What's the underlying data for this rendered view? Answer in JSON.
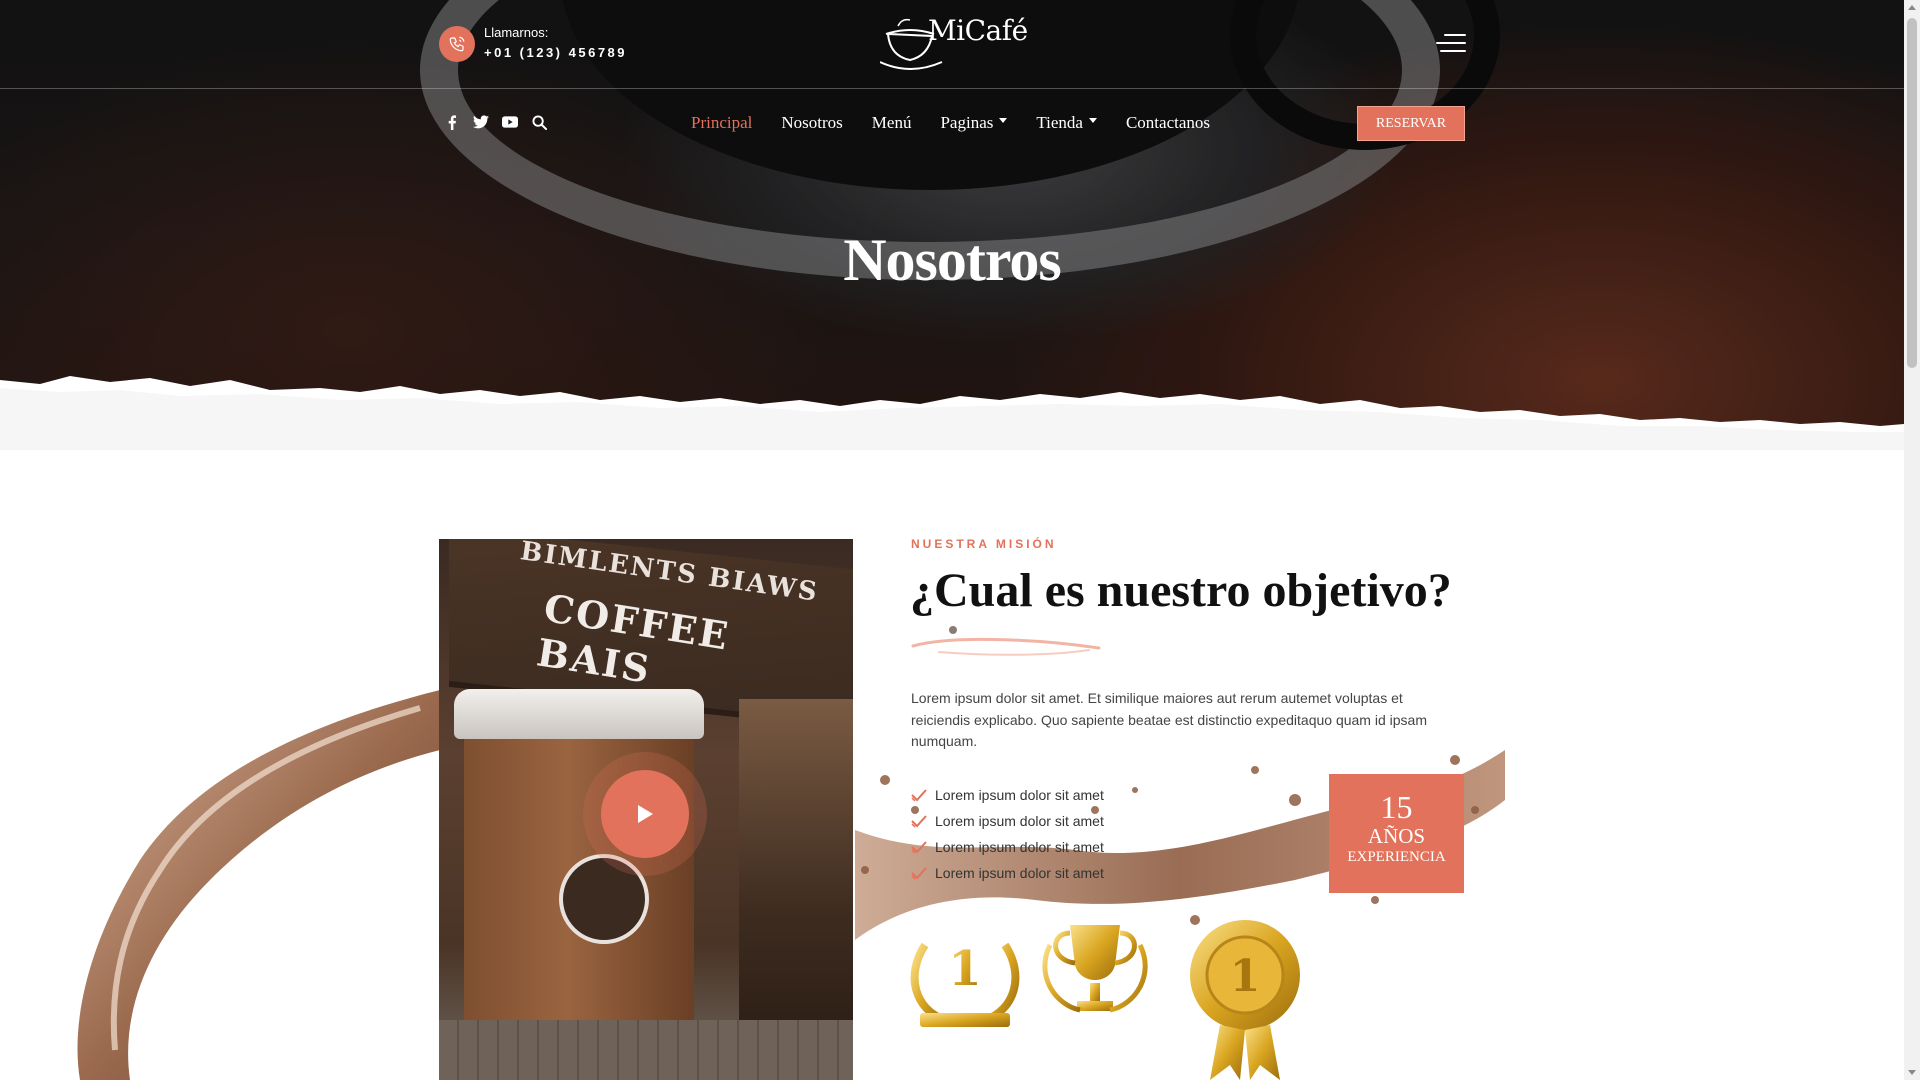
{
  "header": {
    "call_label": "Llamarnos:",
    "call_number": "+01 (123) 456789",
    "logo_text": "MiCafé"
  },
  "nav": {
    "items": [
      {
        "label": "Principal",
        "active": true,
        "dropdown": false
      },
      {
        "label": "Nosotros",
        "active": false,
        "dropdown": false
      },
      {
        "label": "Menú",
        "active": false,
        "dropdown": false
      },
      {
        "label": "Paginas",
        "active": false,
        "dropdown": true
      },
      {
        "label": "Tienda",
        "active": false,
        "dropdown": true
      },
      {
        "label": "Contactanos",
        "active": false,
        "dropdown": false
      }
    ],
    "reserve_label": "RESERVAR",
    "social_icons": [
      "facebook-icon",
      "twitter-icon",
      "youtube-icon",
      "search-icon"
    ]
  },
  "hero": {
    "title": "Nosotros"
  },
  "about": {
    "photo_sign_line1": "BIMLENTS BIAWS",
    "photo_sign_line2": "COFFEE BAIS",
    "eyebrow": "NUESTRA MISIÓN",
    "heading": "¿Cual es nuestro objetivo?",
    "paragraph": "Lorem ipsum dolor sit amet. Et similique maiores aut rerum autemet voluptas et reiciendis explicabo. Quo sapiente beatae est distinctio expeditaquo quam id ipsam numquam.",
    "checklist": [
      "Lorem ipsum dolor sit amet",
      "Lorem ipsum dolor sit amet",
      "Lorem ipsum dolor sit amet",
      "Lorem ipsum dolor sit amet"
    ],
    "badge": {
      "number": "15",
      "years": "AÑOS",
      "experience": "EXPERIENCIA"
    }
  },
  "colors": {
    "accent": "#e2725b",
    "dark": "#161617",
    "text": "#444444"
  }
}
